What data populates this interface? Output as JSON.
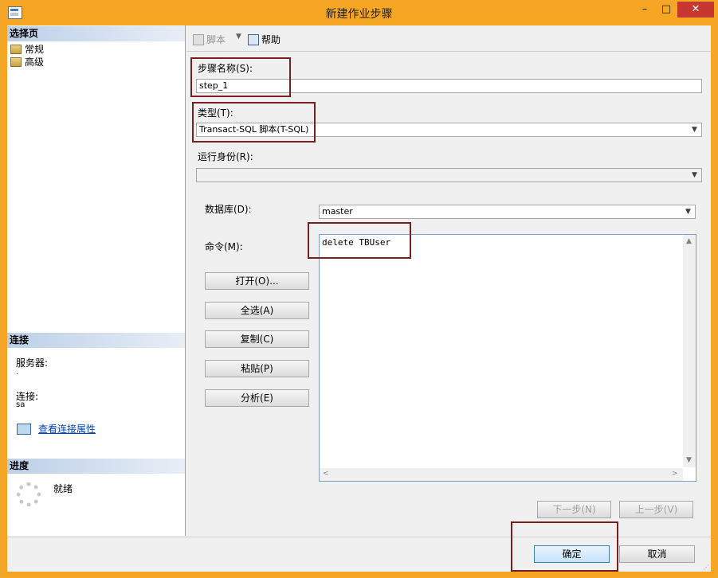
{
  "window": {
    "title": "新建作业步骤",
    "min": "–",
    "max": "□",
    "close": "✕"
  },
  "left": {
    "select_page": "选择页",
    "nav": [
      {
        "label": "常规",
        "icon": "page-icon"
      },
      {
        "label": "高级",
        "icon": "page-icon"
      }
    ],
    "connection_header": "连接",
    "server_label": "服务器:",
    "server_value": ".",
    "conn_label": "连接:",
    "conn_value": "sa",
    "view_conn_props": "查看连接属性",
    "progress_header": "进度",
    "progress_status": "就绪"
  },
  "toolbar": {
    "script": "脚本",
    "dropdown": "▼",
    "help": "帮助"
  },
  "form": {
    "step_name_label": "步骤名称(S):",
    "step_name_value": "step_1",
    "type_label": "类型(T):",
    "type_value": "Transact-SQL 脚本(T-SQL)",
    "run_as_label": "运行身份(R):",
    "run_as_value": "",
    "database_label": "数据库(D):",
    "database_value": "master",
    "command_label": "命令(M):",
    "command_value": "delete TBUser",
    "buttons": {
      "open": "打开(O)...",
      "select_all": "全选(A)",
      "copy": "复制(C)",
      "paste": "粘贴(P)",
      "parse": "分析(E)"
    },
    "next": "下一步(N)",
    "prev": "上一步(V)"
  },
  "footer": {
    "ok": "确定",
    "cancel": "取消"
  },
  "icons": {
    "dropdown": "▼",
    "up": "▲",
    "down": "▼",
    "left": "<",
    "right": ">",
    "grip": "⋰"
  },
  "colors": {
    "title_bar": "#f6a623",
    "close_button": "#c7372f",
    "highlight_box": "#7a1f1f",
    "link": "#0040c0"
  }
}
